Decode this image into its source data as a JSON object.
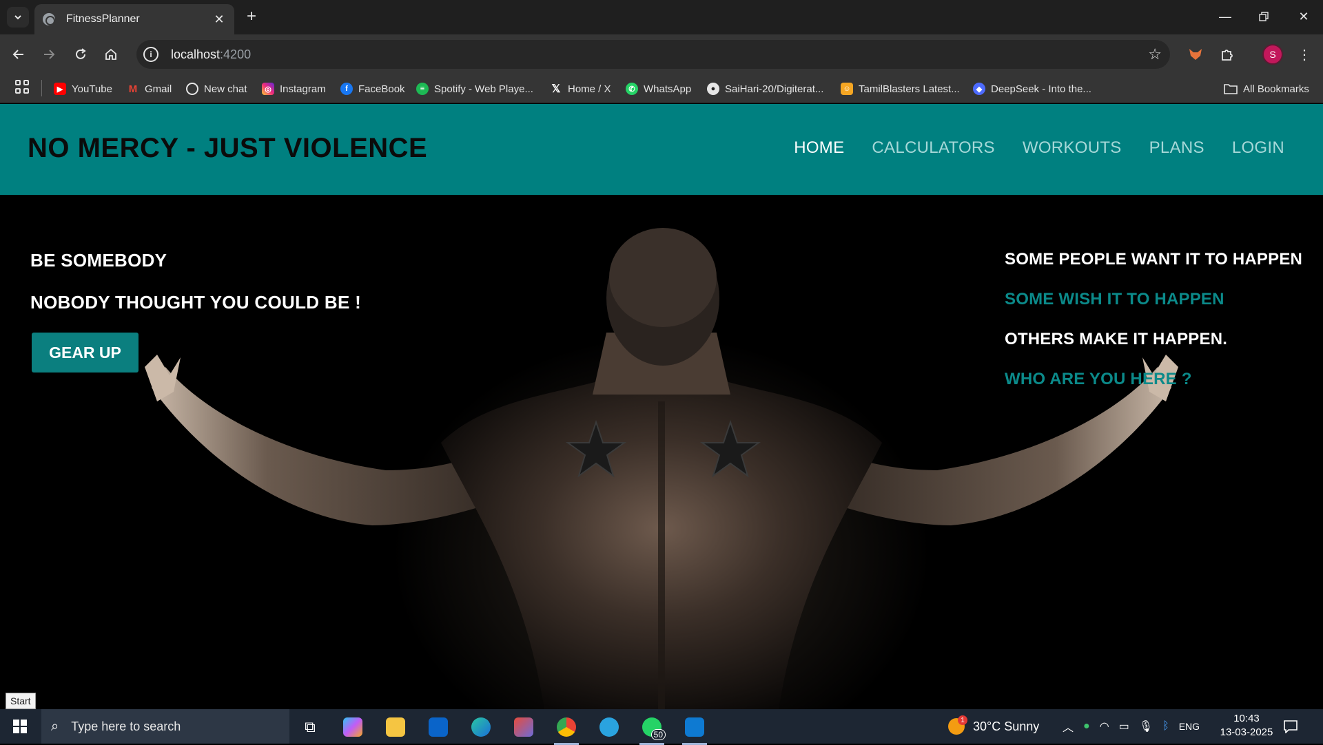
{
  "browser": {
    "tab_title": "FitnessPlanner",
    "url_host": "localhost",
    "url_port": ":4200",
    "profile_initial": "S",
    "bookmarks": [
      {
        "label": "YouTube",
        "color": "#ff0000"
      },
      {
        "label": "Gmail",
        "color": "#ea4335"
      },
      {
        "label": "New chat",
        "color": "#e6e6e6"
      },
      {
        "label": "Instagram",
        "color": "#e1306c"
      },
      {
        "label": "FaceBook",
        "color": "#1877f2"
      },
      {
        "label": "Spotify - Web Playe...",
        "color": "#1db954"
      },
      {
        "label": "Home / X",
        "color": "#000000"
      },
      {
        "label": "WhatsApp",
        "color": "#25d366"
      },
      {
        "label": "SaiHari-20/Digiterat...",
        "color": "#ffffff"
      },
      {
        "label": "TamilBlasters Latest...",
        "color": "#f5a623"
      },
      {
        "label": "DeepSeek - Into the...",
        "color": "#4d6bfe"
      }
    ],
    "all_bookmarks_label": "All Bookmarks"
  },
  "site": {
    "brand": "NO MERCY - JUST VIOLENCE",
    "nav": [
      "HOME",
      "CALCULATORS",
      "WORKOUTS",
      "PLANS",
      "LOGIN"
    ],
    "active_nav": "HOME",
    "accent_color": "#008080"
  },
  "hero": {
    "left_lines": [
      "BE SOMEBODY",
      "NOBODY THOUGHT YOU COULD BE !"
    ],
    "cta_label": "GEAR UP",
    "right_lines": [
      {
        "text": "SOME PEOPLE WANT IT TO HAPPEN",
        "color": "white"
      },
      {
        "text": "SOME WISH IT TO HAPPEN",
        "color": "teal"
      },
      {
        "text": "OTHERS MAKE IT HAPPEN.",
        "color": "white"
      },
      {
        "text": "WHO ARE YOU HERE ?",
        "color": "teal"
      }
    ]
  },
  "status_tooltip": "Start",
  "taskbar": {
    "search_placeholder": "Type here to search",
    "weather": "30°C  Sunny",
    "language": "ENG",
    "time": "10:43",
    "date": "13-03-2025",
    "whatsapp_badge": "50",
    "weather_badge": "1"
  }
}
